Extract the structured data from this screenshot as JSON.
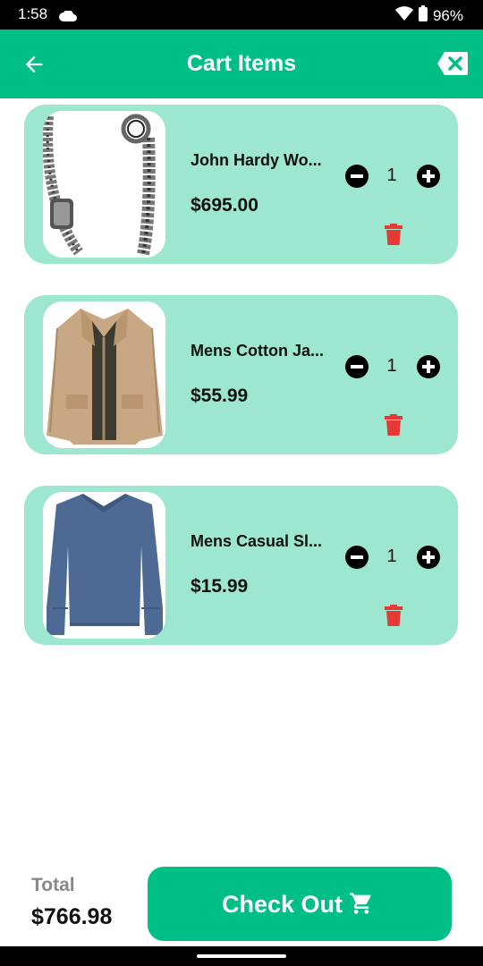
{
  "status_bar": {
    "time": "1:58",
    "battery": "96%"
  },
  "header": {
    "title": "Cart Items"
  },
  "cart": [
    {
      "name": "John Hardy Wo...",
      "price": "$695.00",
      "qty": "1",
      "image": "bracelet"
    },
    {
      "name": "Mens Cotton Ja...",
      "price": "$55.99",
      "qty": "1",
      "image": "jacket"
    },
    {
      "name": "Mens Casual Sl...",
      "price": "$15.99",
      "qty": "1",
      "image": "shirt"
    }
  ],
  "footer": {
    "total_label": "Total",
    "total_value": "$766.98",
    "checkout_label": "Check Out"
  },
  "colors": {
    "primary": "#00bf86",
    "card": "#9de7d0",
    "delete": "#e53935"
  },
  "icons": [
    "back-arrow-icon",
    "clear-backspace-icon",
    "minus-circle-icon",
    "plus-circle-icon",
    "trash-icon",
    "cart-icon"
  ]
}
